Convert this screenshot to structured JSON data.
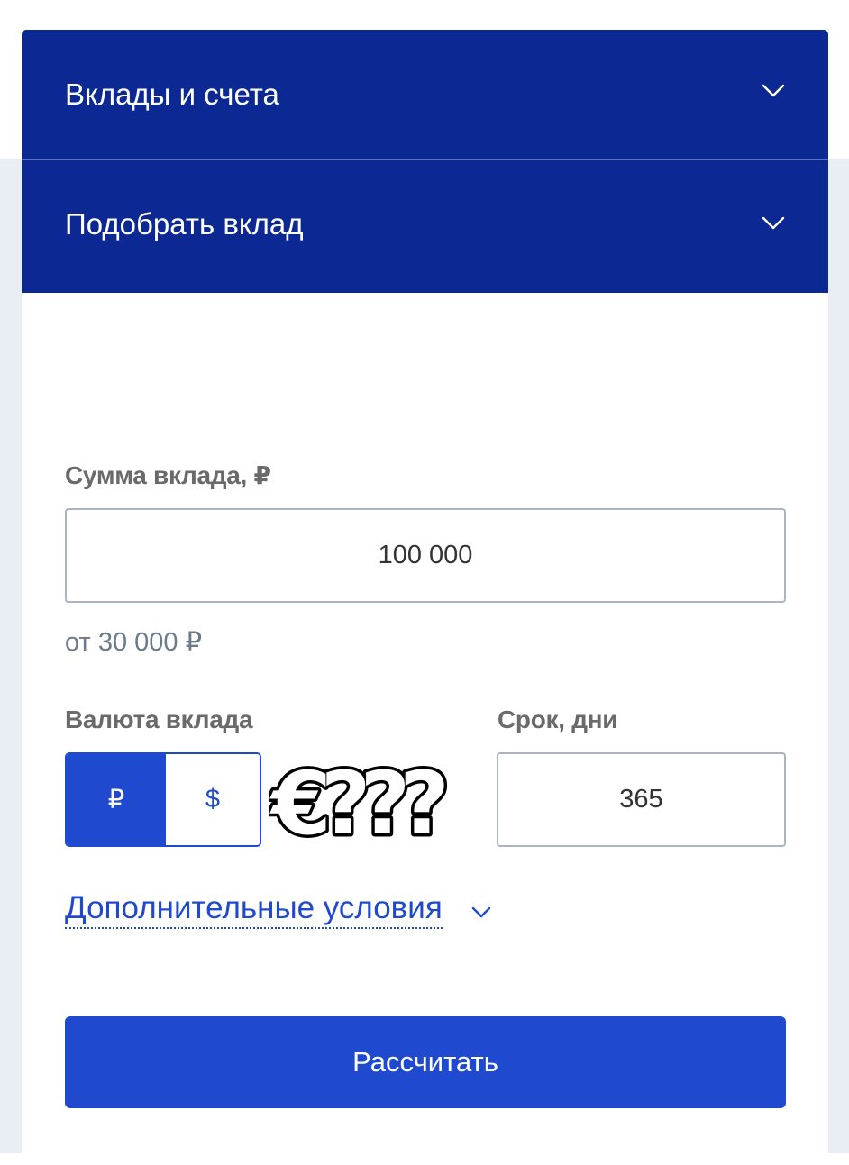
{
  "accordions": [
    {
      "title": "Вклады и счета",
      "icon": "chevron-down-icon"
    },
    {
      "title": "Подобрать вклад",
      "icon": "chevron-down-icon"
    }
  ],
  "calculator": {
    "amount_label": "Сумма вклада, ₽",
    "amount_value": "100 000",
    "amount_hint": "от 30 000 ₽",
    "currency_label": "Валюта вклада",
    "currency_options": [
      "₽",
      "$"
    ],
    "currency_selected": "₽",
    "term_label": "Срок, дни",
    "term_value": "365",
    "more_conditions": "Дополнительные условия",
    "submit": "Рассчитать"
  },
  "sticker_text": "€???",
  "colors": {
    "header": "#0b2893",
    "accent": "#1f4ad0",
    "page_bg": "#e9edf4",
    "label": "#6a6a6a",
    "hint": "#6c7a8b",
    "input_border": "#aab4c4"
  }
}
